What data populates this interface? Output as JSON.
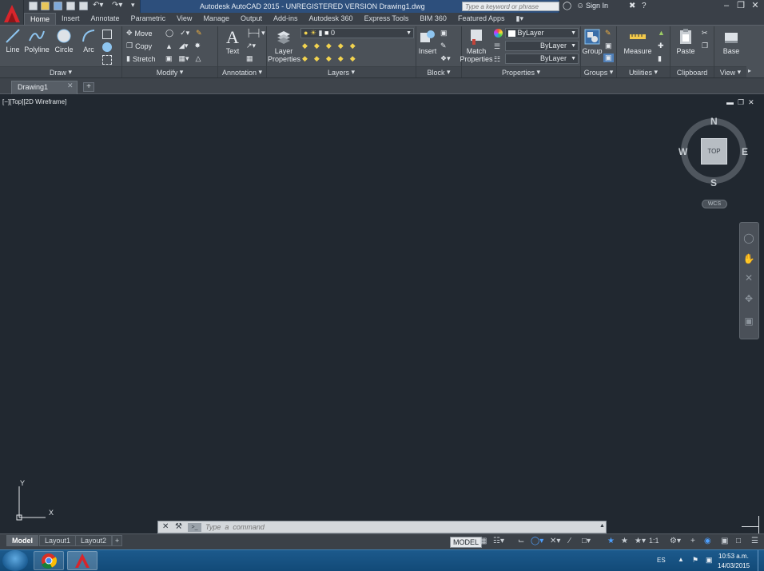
{
  "window": {
    "title": "Autodesk AutoCAD 2015 - UNREGISTERED VERSION    Drawing1.dwg",
    "search_placeholder": "Type a keyword or phrase",
    "signin": "Sign In"
  },
  "ribbon_tabs": [
    "Home",
    "Insert",
    "Annotate",
    "Parametric",
    "View",
    "Manage",
    "Output",
    "Add-ins",
    "Autodesk 360",
    "Express Tools",
    "BIM 360",
    "Featured Apps"
  ],
  "active_tab": "Home",
  "panels": {
    "draw": {
      "title": "Draw",
      "line": "Line",
      "polyline": "Polyline",
      "circle": "Circle",
      "arc": "Arc"
    },
    "modify": {
      "title": "Modify",
      "move": "Move",
      "copy": "Copy",
      "stretch": "Stretch"
    },
    "annotation": {
      "title": "Annotation",
      "text": "Text"
    },
    "layers": {
      "title": "Layers",
      "layer_properties": "Layer Properties",
      "current_layer": "0"
    },
    "block": {
      "title": "Block",
      "insert": "Insert"
    },
    "properties": {
      "title": "Properties",
      "match": "Match Properties",
      "color": "ByLayer",
      "linetype": "ByLayer",
      "lineweight": "ByLayer"
    },
    "groups": {
      "title": "Groups",
      "group": "Group"
    },
    "utilities": {
      "title": "Utilities",
      "measure": "Measure"
    },
    "clipboard": {
      "title": "Clipboard",
      "paste": "Paste"
    },
    "view": {
      "title": "View",
      "base": "Base"
    }
  },
  "file_tab": "Drawing1",
  "viewport": {
    "label": "[−][Top][2D Wireframe]",
    "compass": {
      "n": "N",
      "s": "S",
      "e": "E",
      "w": "W",
      "face": "TOP"
    },
    "wcs": "WCS",
    "ucs_x": "X",
    "ucs_y": "Y"
  },
  "command": {
    "placeholder": "Type  a  command"
  },
  "layout_tabs": [
    "Model",
    "Layout1",
    "Layout2"
  ],
  "status": {
    "model": "MODEL",
    "scale": "1:1"
  },
  "taskbar": {
    "lang": "ES",
    "time": "10:53 a.m.",
    "date": "14/03/2015"
  },
  "colors": {
    "accent": "#2d4f7c",
    "canvas": "#212830",
    "ribbon": "#4b5158"
  }
}
